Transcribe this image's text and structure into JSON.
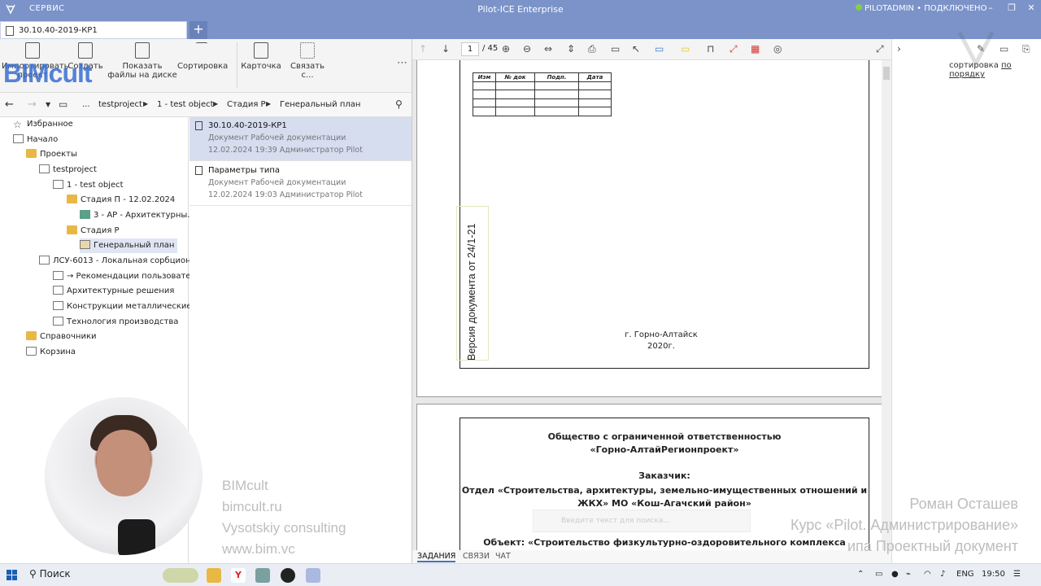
{
  "titlebar": {
    "menu": "СЕРВИС",
    "title": "Pilot-ICE Enterprise",
    "status": "PILOTADMIN • ПОДКЛЮЧЕНО",
    "minimize": "–",
    "restore": "❐",
    "close": "✕"
  },
  "tabs": [
    {
      "label": "30.10.40-2019-КР1"
    }
  ],
  "tab_add": "+",
  "ribbon": {
    "import": "Импортировать проект",
    "create": "Создать",
    "show_files": "Показать файлы на диске",
    "sort": "Сортировка",
    "card": "Карточка",
    "link": "Связать с...",
    "more": "⋯"
  },
  "address": {
    "ellipsis": "...",
    "crumbs": [
      "testproject",
      "1 - test object",
      "Стадия Р",
      "Генеральный план"
    ]
  },
  "tree": {
    "favorites": "Избранное",
    "home": "Начало",
    "projects": "Проекты",
    "testproject": "testproject",
    "test_object": "1 - test object",
    "stage_p": "Стадия П - 12.02.2024",
    "ar": "3 - АР - Архитектурны...",
    "stage_r": "Стадия Р",
    "genplan": "Генеральный план",
    "lsu": "ЛСУ-6013 - Локальная сорбцион...",
    "recommend": "→ Рекомендации пользовате...",
    "arch": "Архитектурные решения",
    "metal": "Конструкции металлические",
    "tech": "Технология производства",
    "refs": "Справочники",
    "trash": "Корзина"
  },
  "documents": [
    {
      "title": "30.10.40-2019-КР1",
      "type": "Документ Рабочей документации",
      "meta": "12.02.2024 19:39 Администратор Pilot"
    },
    {
      "title": "Параметры типа",
      "type": "Документ Рабочей документации",
      "meta": "12.02.2024 19:03 Администратор Pilot"
    }
  ],
  "viewer": {
    "page_current": "1",
    "page_total": "/ 45",
    "stamp_headers": [
      "Изм",
      "№ док",
      "Подп.",
      "Дата"
    ],
    "version_text": "Версия документа от 24/1-21",
    "city": "г. Горно-Алтайск",
    "year": "2020г.",
    "org1": "Общество с ограниченной ответственностью",
    "org2": "«Горно-АлтайРегионпроект»",
    "customer_label": "Заказчик:",
    "customer1": "Отдел «Строительства, архитектуры, земельно-имущественных отношений и",
    "customer2": "ЖКХ» МО «Кош-Агачский район»",
    "object": "Объект:  «Строительство физкультурно-оздоровительного комплекса"
  },
  "viewer_tabs": [
    "ЗАДАНИЯ",
    "СВЯЗИ",
    "ЧАТ"
  ],
  "right_pane": {
    "sort_prefix": "сортировка",
    "sort_link": "по порядку"
  },
  "overlay": {
    "brand": "BIMcult",
    "credits": [
      "BIMcult",
      "bimcult.ru",
      "Vysotskiy consulting",
      "www.bim.vc"
    ],
    "author": "Роман Осташев",
    "course": "Курс «Pilot. Администрирование»",
    "lesson": "ипа Проектный документ",
    "ghost_search": "Введите текст для поиска..."
  },
  "taskbar": {
    "search": "Поиск",
    "lang": "ENG",
    "time": "19:50"
  },
  "colors": {
    "titlebar": "#7b93c9",
    "folder": "#e9b744",
    "selection": "#d6ddef",
    "brand": "#3a6fd0"
  }
}
